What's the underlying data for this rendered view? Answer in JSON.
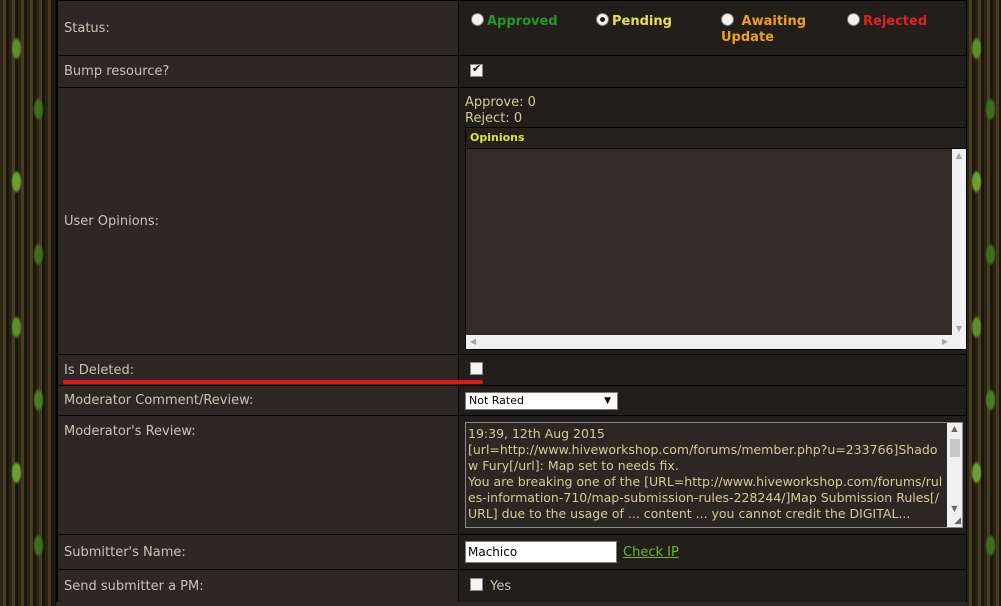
{
  "status": {
    "label": "Status:",
    "options": [
      {
        "label": "Approved",
        "color": "#229922",
        "selected": false
      },
      {
        "label": "Pending",
        "color": "#e8e04a",
        "selected": true
      },
      {
        "label": "Awaiting Update",
        "line1": "Awaiting",
        "line2": "Update",
        "color": "#f0a020",
        "selected": false
      },
      {
        "label": "Rejected",
        "color": "#e02020",
        "selected": false
      }
    ]
  },
  "bump": {
    "label": "Bump resource?",
    "checked": true
  },
  "opinions": {
    "label": "User Opinions:",
    "approve": "Approve: 0",
    "reject": "Reject: 0",
    "box_header": "Opinions"
  },
  "deleted": {
    "label": "Is Deleted:",
    "checked": false
  },
  "mod_comment": {
    "label": "Moderator Comment/Review:",
    "selected": "Not Rated"
  },
  "mod_review": {
    "label": "Moderator's Review:",
    "text": "19:39, 12th Aug 2015\n[url=http://www.hiveworkshop.com/forums/member.php?u=233766]Shadow Fury[/url]: Map set to needs fix.\nYou are breaking one of the [URL=http://www.hiveworkshop.com/forums/rules-information-710/map-submission-rules-228244/]Map Submission Rules[/URL] due to the usage of ... content ... you cannot credit the DIGITAL..."
  },
  "submitter": {
    "label": "Submitter's Name:",
    "value": "Machico",
    "check_ip": "Check IP"
  },
  "send_pm": {
    "label": "Send submitter a PM:",
    "yes": "Yes",
    "checked": false
  }
}
